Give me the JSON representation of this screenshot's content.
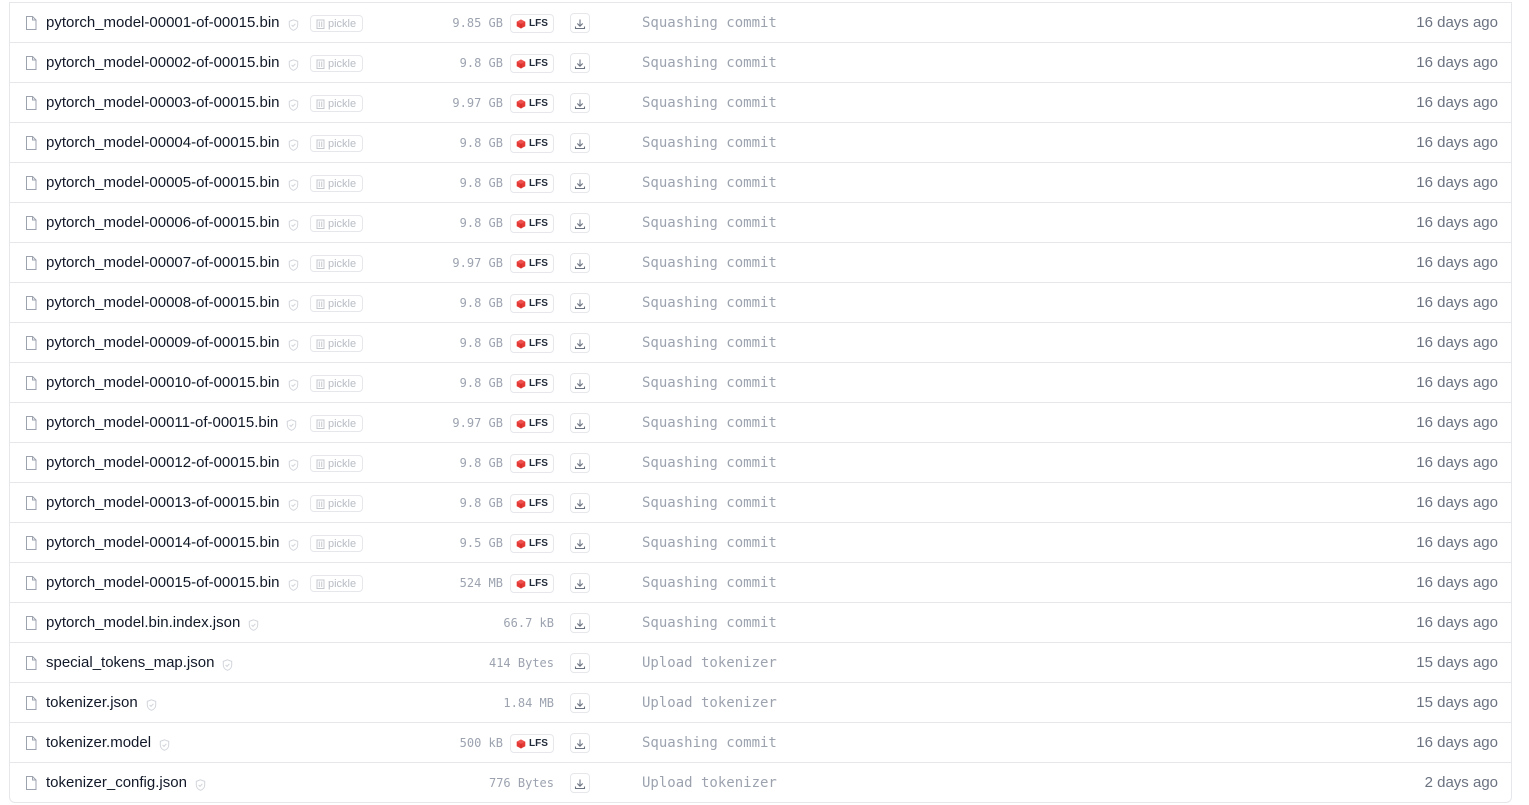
{
  "files": [
    {
      "name": "pytorch_model-00001-of-00015.bin",
      "pickle": "pickle",
      "size": "9.85 GB",
      "lfs": "LFS",
      "commit": "Squashing commit",
      "date": "16 days ago"
    },
    {
      "name": "pytorch_model-00002-of-00015.bin",
      "pickle": "pickle",
      "size": "9.8 GB",
      "lfs": "LFS",
      "commit": "Squashing commit",
      "date": "16 days ago"
    },
    {
      "name": "pytorch_model-00003-of-00015.bin",
      "pickle": "pickle",
      "size": "9.97 GB",
      "lfs": "LFS",
      "commit": "Squashing commit",
      "date": "16 days ago"
    },
    {
      "name": "pytorch_model-00004-of-00015.bin",
      "pickle": "pickle",
      "size": "9.8 GB",
      "lfs": "LFS",
      "commit": "Squashing commit",
      "date": "16 days ago"
    },
    {
      "name": "pytorch_model-00005-of-00015.bin",
      "pickle": "pickle",
      "size": "9.8 GB",
      "lfs": "LFS",
      "commit": "Squashing commit",
      "date": "16 days ago"
    },
    {
      "name": "pytorch_model-00006-of-00015.bin",
      "pickle": "pickle",
      "size": "9.8 GB",
      "lfs": "LFS",
      "commit": "Squashing commit",
      "date": "16 days ago"
    },
    {
      "name": "pytorch_model-00007-of-00015.bin",
      "pickle": "pickle",
      "size": "9.97 GB",
      "lfs": "LFS",
      "commit": "Squashing commit",
      "date": "16 days ago"
    },
    {
      "name": "pytorch_model-00008-of-00015.bin",
      "pickle": "pickle",
      "size": "9.8 GB",
      "lfs": "LFS",
      "commit": "Squashing commit",
      "date": "16 days ago"
    },
    {
      "name": "pytorch_model-00009-of-00015.bin",
      "pickle": "pickle",
      "size": "9.8 GB",
      "lfs": "LFS",
      "commit": "Squashing commit",
      "date": "16 days ago"
    },
    {
      "name": "pytorch_model-00010-of-00015.bin",
      "pickle": "pickle",
      "size": "9.8 GB",
      "lfs": "LFS",
      "commit": "Squashing commit",
      "date": "16 days ago"
    },
    {
      "name": "pytorch_model-00011-of-00015.bin",
      "pickle": "pickle",
      "size": "9.97 GB",
      "lfs": "LFS",
      "commit": "Squashing commit",
      "date": "16 days ago"
    },
    {
      "name": "pytorch_model-00012-of-00015.bin",
      "pickle": "pickle",
      "size": "9.8 GB",
      "lfs": "LFS",
      "commit": "Squashing commit",
      "date": "16 days ago"
    },
    {
      "name": "pytorch_model-00013-of-00015.bin",
      "pickle": "pickle",
      "size": "9.8 GB",
      "lfs": "LFS",
      "commit": "Squashing commit",
      "date": "16 days ago"
    },
    {
      "name": "pytorch_model-00014-of-00015.bin",
      "pickle": "pickle",
      "size": "9.5 GB",
      "lfs": "LFS",
      "commit": "Squashing commit",
      "date": "16 days ago"
    },
    {
      "name": "pytorch_model-00015-of-00015.bin",
      "pickle": "pickle",
      "size": "524 MB",
      "lfs": "LFS",
      "commit": "Squashing commit",
      "date": "16 days ago"
    },
    {
      "name": "pytorch_model.bin.index.json",
      "pickle": null,
      "size": "66.7 kB",
      "lfs": null,
      "commit": "Squashing commit",
      "date": "16 days ago"
    },
    {
      "name": "special_tokens_map.json",
      "pickle": null,
      "size": "414 Bytes",
      "lfs": null,
      "commit": "Upload tokenizer",
      "date": "15 days ago"
    },
    {
      "name": "tokenizer.json",
      "pickle": null,
      "size": "1.84 MB",
      "lfs": null,
      "commit": "Upload tokenizer",
      "date": "15 days ago"
    },
    {
      "name": "tokenizer.model",
      "pickle": null,
      "size": "500 kB",
      "lfs": "LFS",
      "commit": "Squashing commit",
      "date": "16 days ago"
    },
    {
      "name": "tokenizer_config.json",
      "pickle": null,
      "size": "776 Bytes",
      "lfs": null,
      "commit": "Upload tokenizer",
      "date": "2 days ago"
    }
  ],
  "icons": {
    "file": "file-icon",
    "safe": "shield-check-icon",
    "pickle": "pickle-jar-icon",
    "lfs": "lfs-cube-icon",
    "download": "download-icon"
  },
  "colors": {
    "border": "#e5e7eb",
    "lfs_cube": "#e53935",
    "muted_text": "#9ca3af",
    "date_text": "#6b7280"
  }
}
